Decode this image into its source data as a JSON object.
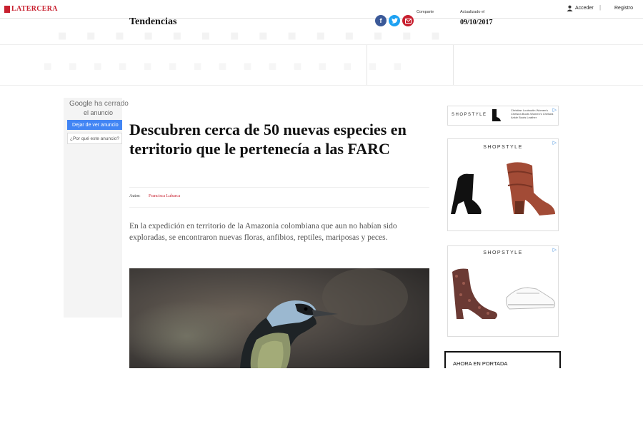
{
  "header": {
    "logo_text": "LATERCERA",
    "login_label": "Acceder",
    "separator": "|",
    "register_label": "Registro",
    "brand_color": "#c8202f"
  },
  "section": {
    "title": "Tendencias",
    "share_label": "Comparte",
    "share_icons": [
      "facebook-icon",
      "twitter-icon",
      "mail-icon"
    ],
    "updated_label": "Actualizado el",
    "updated_date": "09/10/2017"
  },
  "left_ad": {
    "google_brand": "Google",
    "closed_text": "ha cerrado",
    "closed_text_2": "el anuncio",
    "stop_button": "Dejar de ver anuncio",
    "why_button": "¿Por qué este anuncio?"
  },
  "article": {
    "headline": "Descubren cerca de 50 nuevas especies en territorio que le pertenecía a las FARC",
    "author_label": "Autor:",
    "author_name": "Francisca Lubarca",
    "lede": "En la expedición en territorio de la Amazonia colombiana que aun no habían sido exploradas, se encontraron nuevas floras, anfibios, reptiles, mariposas y peces."
  },
  "right_rail": {
    "ad_small_brand": "SHOPSTYLE",
    "ad_small_text": "Christian Louboutin Women's Chelsea Boots Women's Chelsea Ankle Boots Leather",
    "ad1_brand": "SHOPSTYLE",
    "ad2_brand": "SHOPSTYLE",
    "portada_label": "AHORA EN PORTADA"
  }
}
